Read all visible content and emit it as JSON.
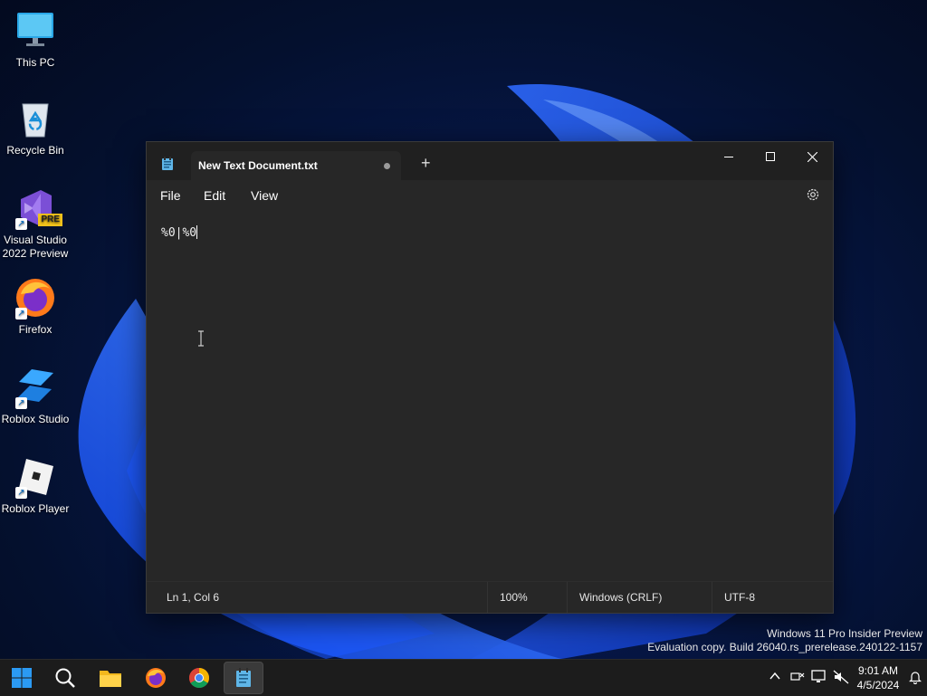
{
  "desktop": {
    "icons": [
      {
        "label_line1": "This PC",
        "label_line2": ""
      },
      {
        "label_line1": "Recycle Bin",
        "label_line2": ""
      },
      {
        "label_line1": "Visual Studio",
        "label_line2": "2022 Preview",
        "badge": "PRE"
      },
      {
        "label_line1": "Firefox",
        "label_line2": ""
      },
      {
        "label_line1": "Roblox Studio",
        "label_line2": ""
      },
      {
        "label_line1": "Roblox Player",
        "label_line2": ""
      }
    ]
  },
  "notepad": {
    "tab_title": "New Text Document.txt",
    "menu": [
      "File",
      "Edit",
      "View"
    ],
    "content": "%0|%0",
    "status": {
      "position": "Ln 1, Col 6",
      "zoom": "100%",
      "line_endings": "Windows (CRLF)",
      "encoding": "UTF-8"
    }
  },
  "watermark": {
    "line1": "Windows 11 Pro Insider Preview",
    "line2": "Evaluation copy. Build 26040.rs_prerelease.240122-1157"
  },
  "taskbar": {
    "time": "9:01 AM",
    "date": "4/5/2024"
  },
  "colors": {
    "accent": "#0067c0",
    "window_bg": "#272727",
    "titlebar_bg": "#202020",
    "taskbar_bg": "#1c1c1c"
  }
}
